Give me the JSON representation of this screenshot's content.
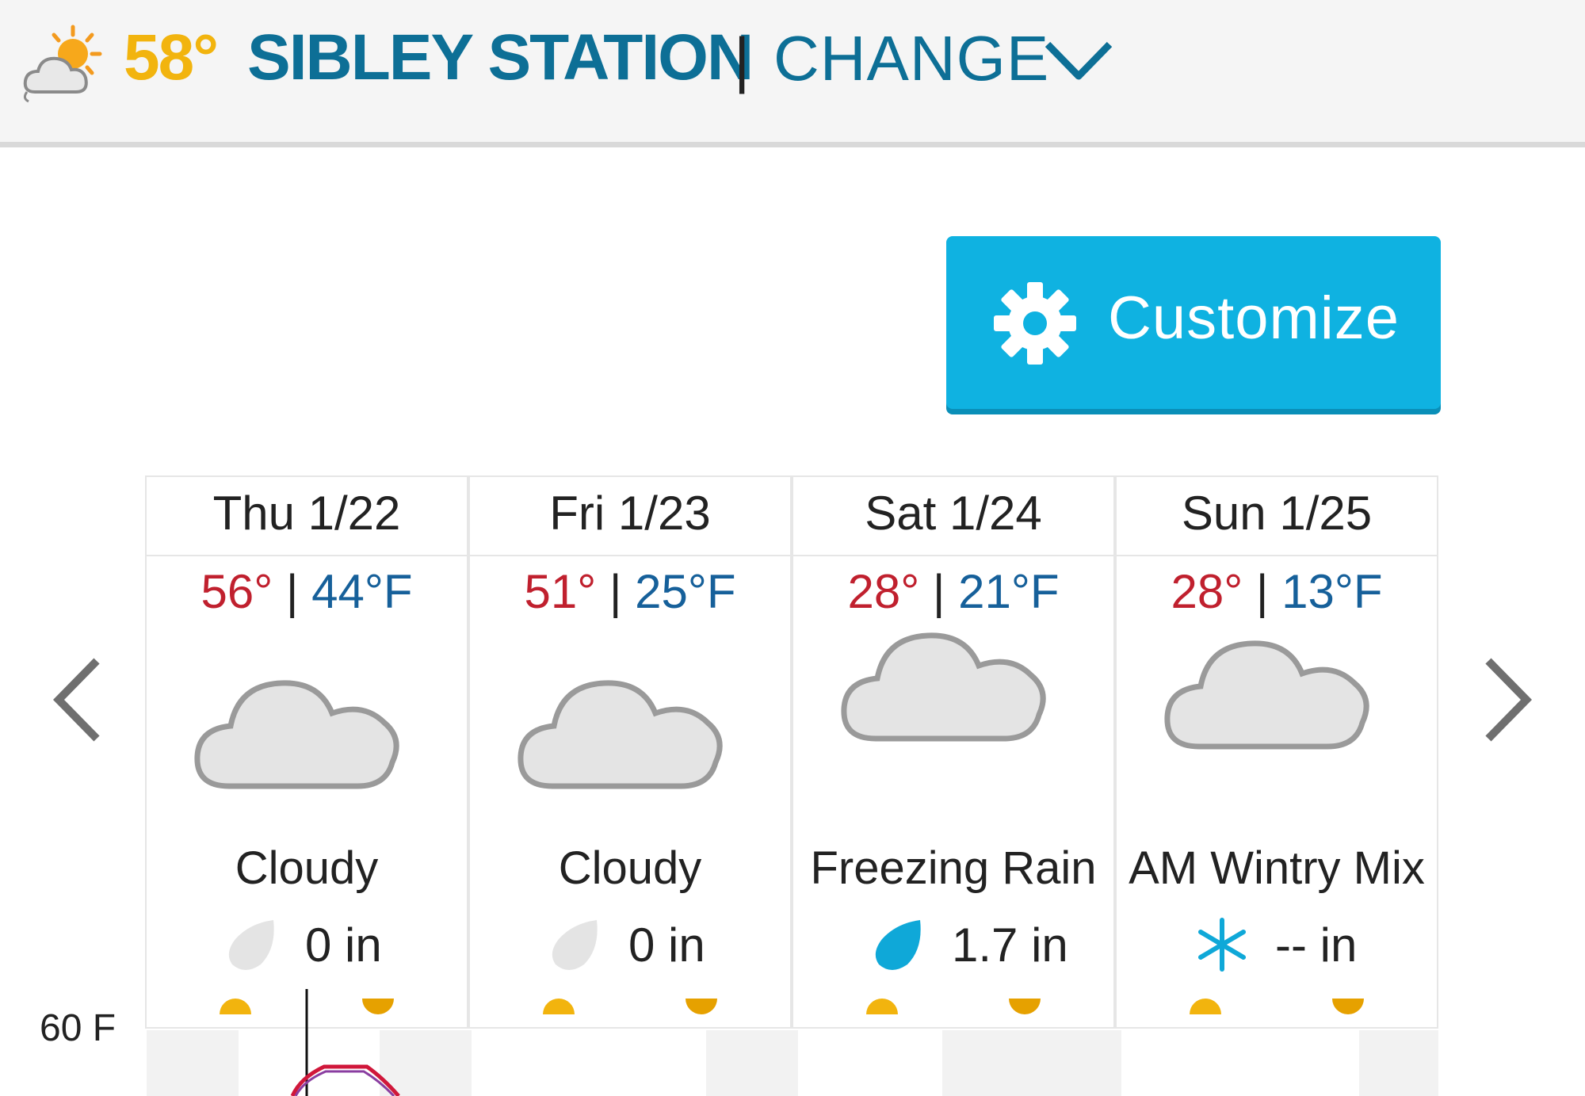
{
  "header": {
    "current_temp": "58°",
    "station": "SIBLEY STATION",
    "separator": "|",
    "change_label": "CHANGE",
    "icon": "partly-cloudy-icon"
  },
  "customize": {
    "label": "Customize",
    "icon": "gear-icon"
  },
  "forecast": {
    "days": [
      {
        "date": "Thu 1/22",
        "high": "56°",
        "sep": "|",
        "low": "44°F",
        "condition": "Cloudy",
        "icon": "cloud-icon",
        "precip_icon": "raindrop-icon",
        "precip": "0 in"
      },
      {
        "date": "Fri 1/23",
        "high": "51°",
        "sep": "|",
        "low": "25°F",
        "condition": "Cloudy",
        "icon": "cloud-icon",
        "precip_icon": "raindrop-icon",
        "precip": "0 in"
      },
      {
        "date": "Sat 1/24",
        "high": "28°",
        "sep": "|",
        "low": "21°F",
        "condition": "Freezing Rain",
        "icon": "freezing-rain-icon",
        "precip_icon": "raindrop-icon",
        "precip": "1.7 in"
      },
      {
        "date": "Sun 1/25",
        "high": "28°",
        "sep": "|",
        "low": "13°F",
        "condition": "AM Wintry Mix",
        "icon": "wintry-mix-icon",
        "precip_icon": "snowflake-icon",
        "precip": "-- in"
      }
    ]
  },
  "chart": {
    "y_label": "60 F"
  },
  "colors": {
    "accent": "#0fb2e1",
    "station": "#0d6f96",
    "current_temp": "#f2b40e",
    "high": "#c0202e",
    "low": "#16609a"
  }
}
